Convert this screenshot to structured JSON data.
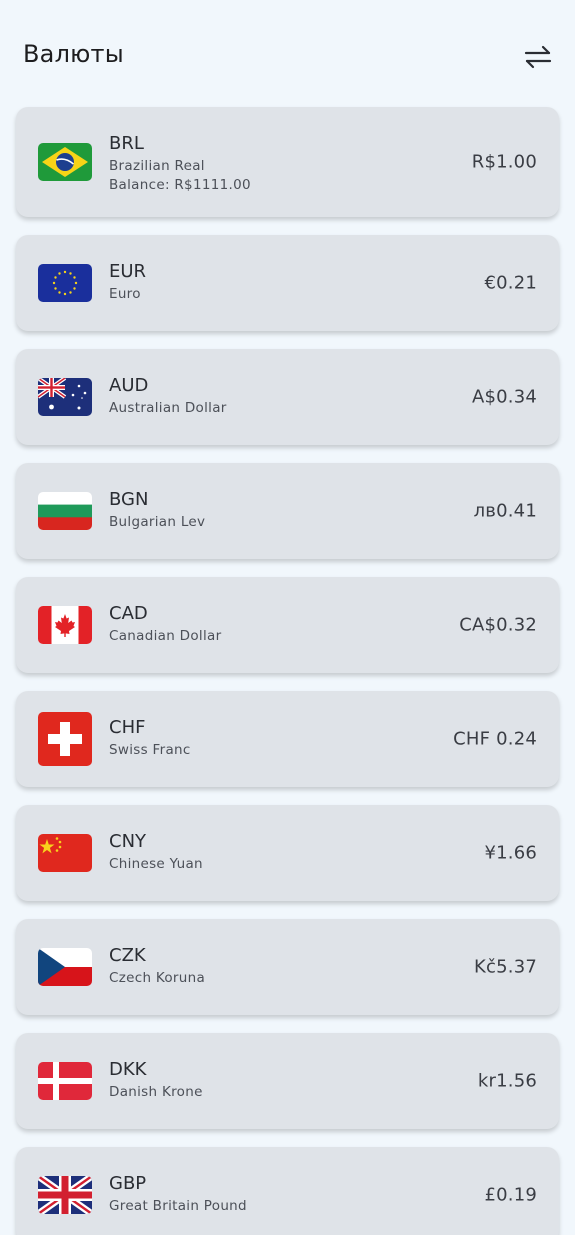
{
  "header": {
    "title": "Валюты",
    "swap_icon": "swap-arrows-icon"
  },
  "currencies": [
    {
      "code": "BRL",
      "name": "Brazilian Real",
      "balance": "Balance: R$1111.00",
      "rate": "R$1.00",
      "flag": "brazil-flag-icon"
    },
    {
      "code": "EUR",
      "name": "Euro",
      "rate": "€0.21",
      "flag": "eu-flag-icon"
    },
    {
      "code": "AUD",
      "name": "Australian Dollar",
      "rate": "A$0.34",
      "flag": "australia-flag-icon"
    },
    {
      "code": "BGN",
      "name": "Bulgarian Lev",
      "rate": "лв0.41",
      "flag": "bulgaria-flag-icon"
    },
    {
      "code": "CAD",
      "name": "Canadian Dollar",
      "rate": "CA$0.32",
      "flag": "canada-flag-icon"
    },
    {
      "code": "CHF",
      "name": "Swiss Franc",
      "rate": "CHF 0.24",
      "flag": "switzerland-flag-icon"
    },
    {
      "code": "CNY",
      "name": "Chinese Yuan",
      "rate": "¥1.66",
      "flag": "china-flag-icon"
    },
    {
      "code": "CZK",
      "name": "Czech Koruna",
      "rate": "Kč5.37",
      "flag": "czech-flag-icon"
    },
    {
      "code": "DKK",
      "name": "Danish Krone",
      "rate": "kr1.56",
      "flag": "denmark-flag-icon"
    },
    {
      "code": "GBP",
      "name": "Great Britain Pound",
      "rate": "£0.19",
      "flag": "uk-flag-icon"
    }
  ]
}
